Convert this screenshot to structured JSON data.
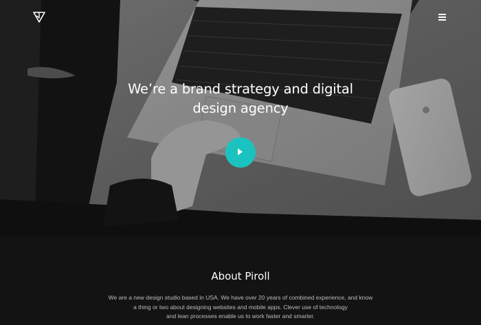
{
  "brand": {
    "logo_icon": "triangle-logo-icon",
    "name": "Piroll"
  },
  "nav": {
    "menu_icon": "hamburger-menu-icon"
  },
  "hero": {
    "title_line1": "We’re a brand strategy and digital",
    "title_line2": "design agency",
    "play_icon": "play-icon",
    "accent_color": "#1bc3c0",
    "image": "laptop-and-phone-on-fur-rug-photo"
  },
  "about": {
    "title": "About Piroll",
    "text_lines": [
      "We are a new design studio based in USA. We have over 20 years of combined experience, and know",
      "a thing or two about designing websites and mobile apps. Clever use of technology",
      "and lean processes enable us to work faster and smarter."
    ],
    "background_color": "#131313"
  }
}
